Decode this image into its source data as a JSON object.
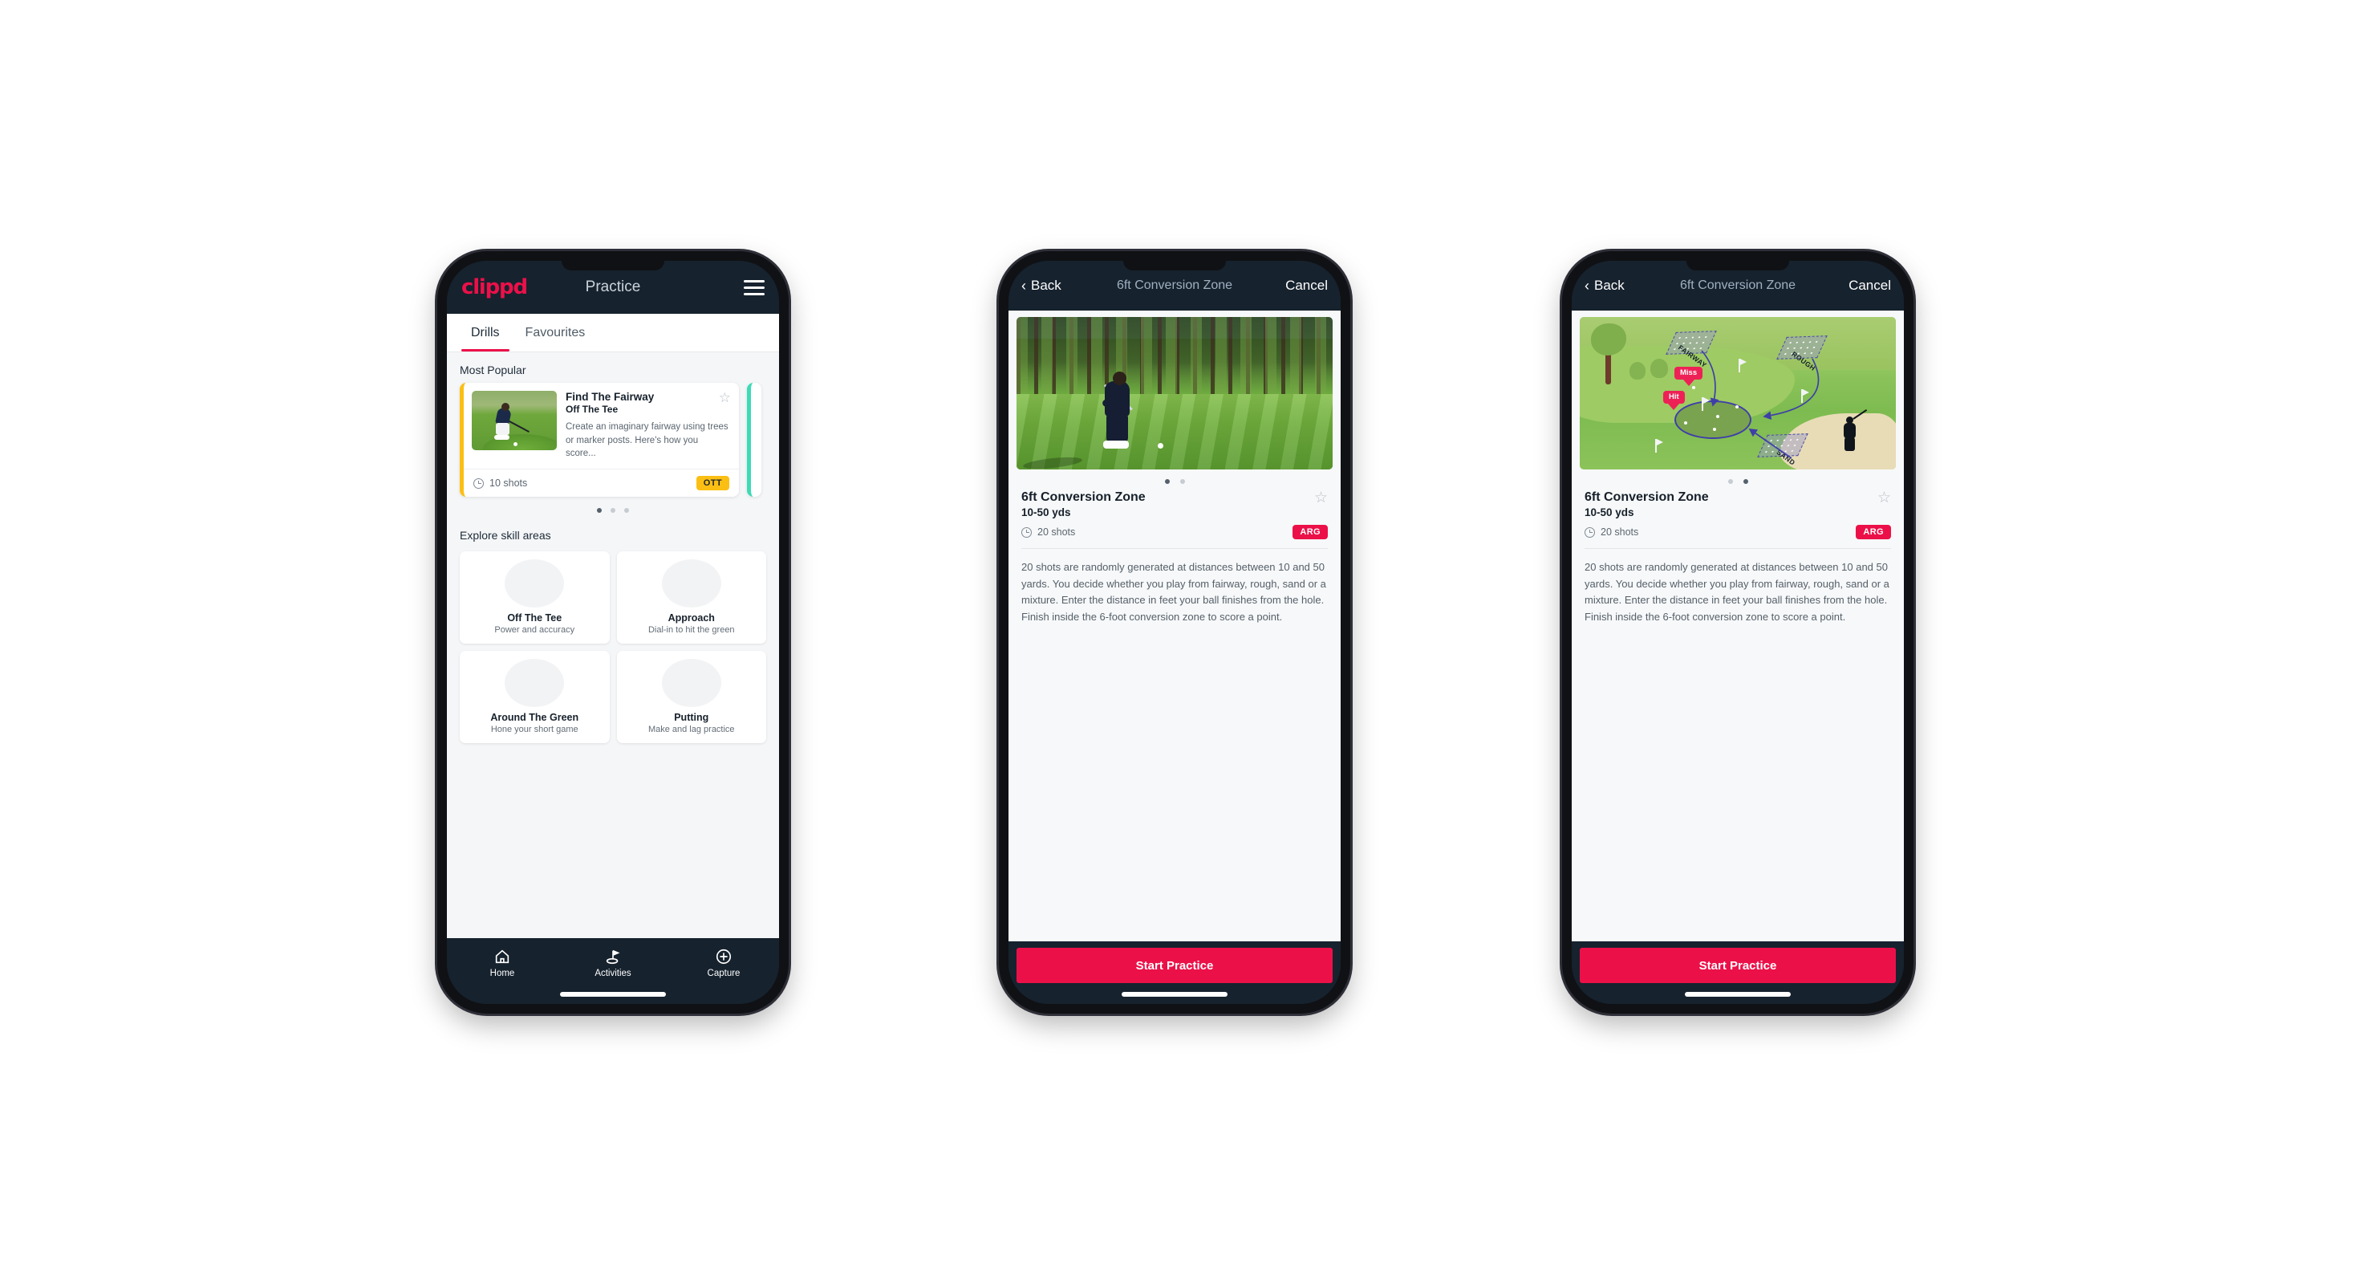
{
  "app": {
    "brand": "clippd",
    "accent": "#ec1049",
    "header_bg": "#16222e",
    "amber": "#fbbf14",
    "teal": "#3ddbb6"
  },
  "phone1": {
    "appbar": {
      "brand": "clippd",
      "title": "Practice",
      "menu_icon": "hamburger-menu-icon"
    },
    "tabs": [
      {
        "label": "Drills",
        "active": true
      },
      {
        "label": "Favourites",
        "active": false
      }
    ],
    "sections": {
      "most_popular_heading": "Most Popular",
      "explore_heading": "Explore skill areas"
    },
    "featured_drill": {
      "title": "Find The Fairway",
      "subtitle": "Off The Tee",
      "description": "Create an imaginary fairway using trees or marker posts. Here's how you score...",
      "shots": "10 shots",
      "badge": "OTT",
      "badge_color": "#fbbf14",
      "accent_bar": "#fbbf14",
      "favourite_icon": "star-outline-icon"
    },
    "carousel_dots": {
      "count": 3,
      "active_index": 0
    },
    "skill_areas": [
      {
        "name": "Off The Tee",
        "tagline": "Power and accuracy",
        "icon": "tee-fan-icon",
        "dot_color": "#f5a623"
      },
      {
        "name": "Approach",
        "tagline": "Dial-in to hit the green",
        "icon": "approach-green-icon",
        "dot_color": "#2fd6a8"
      },
      {
        "name": "Around The Green",
        "tagline": "Hone your short game",
        "icon": "around-green-icon",
        "dot_color": "#ec1049"
      },
      {
        "name": "Putting",
        "tagline": "Make and lag practice",
        "icon": "putting-rings-icon",
        "dot_color": "#9b1fd6"
      }
    ],
    "bottom_nav": [
      {
        "label": "Home",
        "icon": "home-icon",
        "active": false
      },
      {
        "label": "Activities",
        "icon": "golf-flag-icon",
        "active": true
      },
      {
        "label": "Capture",
        "icon": "plus-circle-icon",
        "active": false
      }
    ]
  },
  "phone2": {
    "navbar": {
      "back": "Back",
      "title": "6ft Conversion Zone",
      "cancel": "Cancel",
      "back_icon": "chevron-left-icon"
    },
    "hero": {
      "type": "photo",
      "alt": "golfer-chipping-photo"
    },
    "carousel_dots": {
      "count": 2,
      "active_index": 0
    },
    "drill": {
      "title": "6ft Conversion Zone",
      "distance": "10-50 yds",
      "shots": "20 shots",
      "badge": "ARG",
      "badge_color": "#ec1049",
      "favourite_icon": "star-outline-icon",
      "description": "20 shots are randomly generated at distances between 10 and 50 yards. You decide whether you play from fairway, rough, sand or a mixture. Enter the distance in feet your ball finishes from the hole. Finish inside the 6-foot conversion zone to score a point."
    },
    "cta": "Start Practice"
  },
  "phone3": {
    "navbar": {
      "back": "Back",
      "title": "6ft Conversion Zone",
      "cancel": "Cancel",
      "back_icon": "chevron-left-icon"
    },
    "hero": {
      "type": "illustration",
      "alt": "golf-course-diagram",
      "zone_labels": [
        "FAIRWAY",
        "ROUGH",
        "SAND"
      ],
      "cues": [
        "Miss",
        "Hit"
      ]
    },
    "carousel_dots": {
      "count": 2,
      "active_index": 1
    },
    "drill": {
      "title": "6ft Conversion Zone",
      "distance": "10-50 yds",
      "shots": "20 shots",
      "badge": "ARG",
      "badge_color": "#ec1049",
      "favourite_icon": "star-outline-icon",
      "description": "20 shots are randomly generated at distances between 10 and 50 yards. You decide whether you play from fairway, rough, sand or a mixture. Enter the distance in feet your ball finishes from the hole. Finish inside the 6-foot conversion zone to score a point."
    },
    "cta": "Start Practice"
  }
}
